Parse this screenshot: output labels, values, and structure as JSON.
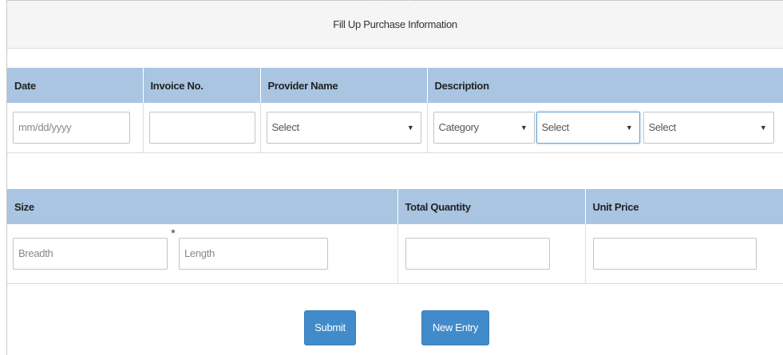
{
  "form": {
    "title": "Fill Up Purchase Information"
  },
  "table1": {
    "headers": {
      "date": "Date",
      "invoice": "Invoice No.",
      "provider": "Provider Name",
      "description": "Description"
    },
    "fields": {
      "date_placeholder": "mm/dd/yyyy",
      "invoice_value": "",
      "provider_selected": "Select",
      "category_selected": "Category",
      "desc_select_2": "Select",
      "desc_select_3": "Select"
    }
  },
  "table2": {
    "headers": {
      "size": "Size",
      "total_quantity": "Total Quantity",
      "unit_price": "Unit Price"
    },
    "fields": {
      "breadth_placeholder": "Breadth",
      "times_symbol": "*",
      "length_placeholder": "Length",
      "total_quantity_value": "",
      "unit_price_value": ""
    }
  },
  "buttons": {
    "submit": "Submit",
    "new_entry": "New Entry"
  },
  "icons": {
    "dropdown_arrow": "▼"
  },
  "colors": {
    "header_bg": "#a9c5e2",
    "button_bg": "#428bca",
    "title_bg": "#f5f5f5"
  }
}
